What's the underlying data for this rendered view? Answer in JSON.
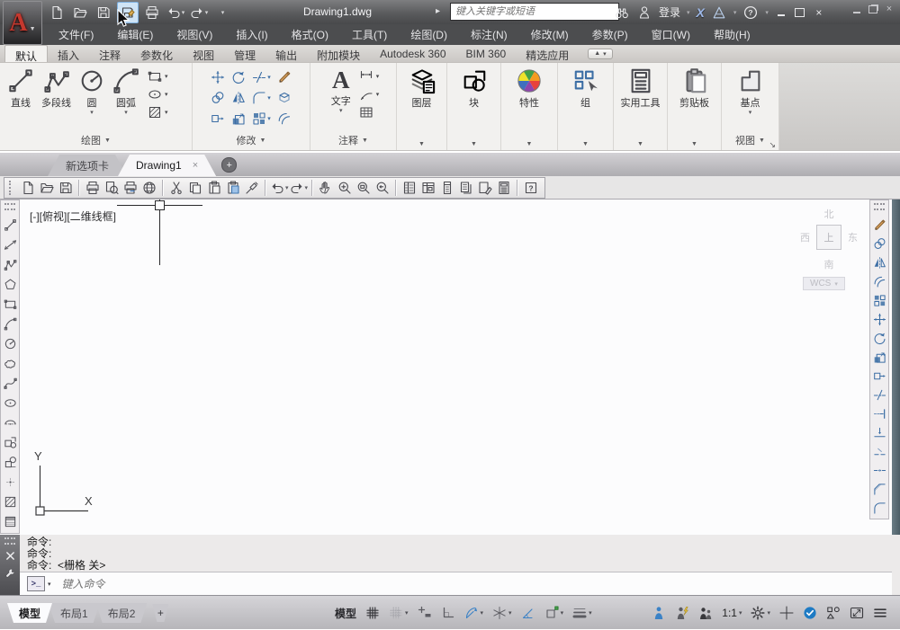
{
  "titlebar": {
    "title": "Drawing1.dwg",
    "overflow_arrow": "▸",
    "search_placeholder": "键入关键字或短语",
    "login": "登录",
    "qat": [
      {
        "icon": "new",
        "name": "qat-new-button"
      },
      {
        "icon": "open",
        "name": "qat-open-button"
      },
      {
        "icon": "save",
        "name": "qat-save-button"
      },
      {
        "icon": "saveas",
        "name": "qat-saveas-button",
        "highlight": true
      },
      {
        "icon": "print",
        "name": "qat-plot-button"
      },
      {
        "icon": "undo",
        "name": "qat-undo-button",
        "dd": "▾"
      },
      {
        "icon": "redo",
        "name": "qat-redo-button",
        "dd": "▾"
      },
      {
        "name": "qat-menu-button",
        "dd": "▾"
      }
    ]
  },
  "menubar": {
    "items": [
      "文件(F)",
      "编辑(E)",
      "视图(V)",
      "插入(I)",
      "格式(O)",
      "工具(T)",
      "绘图(D)",
      "标注(N)",
      "修改(M)",
      "参数(P)",
      "窗口(W)",
      "帮助(H)"
    ]
  },
  "ribbon": {
    "tabs": [
      {
        "label": "默认",
        "active": true
      },
      {
        "label": "插入"
      },
      {
        "label": "注释"
      },
      {
        "label": "参数化"
      },
      {
        "label": "视图"
      },
      {
        "label": "管理"
      },
      {
        "label": "输出"
      },
      {
        "label": "附加模块"
      },
      {
        "label": "Autodesk 360"
      },
      {
        "label": "BIM 360"
      },
      {
        "label": "精选应用"
      }
    ],
    "panel_dd": "▼",
    "panels": {
      "draw": {
        "label": "绘图",
        "big": [
          {
            "icon": "line",
            "label": "直线"
          },
          {
            "icon": "polyline",
            "label": "多段线"
          },
          {
            "icon": "circle",
            "label": "圆",
            "dd": "▾"
          },
          {
            "icon": "arc",
            "label": "圆弧",
            "dd": "▾"
          }
        ],
        "small": [
          {
            "icon": "rectangle",
            "dd": "▾"
          },
          {
            "icon": "ellipse",
            "dd": "▾"
          },
          {
            "icon": "hatch",
            "dd": "▾"
          }
        ]
      },
      "modify": {
        "label": "修改",
        "grid": [
          {
            "icon": "move"
          },
          {
            "icon": "copy"
          },
          {
            "icon": "stretch"
          },
          {
            "icon": "rotate"
          },
          {
            "icon": "mirror"
          },
          {
            "icon": "scale"
          },
          {
            "icon": "trim",
            "dd": "▾"
          },
          {
            "icon": "fillet",
            "dd": "▾"
          },
          {
            "icon": "array",
            "dd": "▾"
          },
          {
            "icon": "erase"
          },
          {
            "icon": "explode"
          },
          {
            "icon": "offset"
          }
        ]
      },
      "annotate": {
        "label": "注释",
        "text_label": "文字",
        "text_dd": "▾",
        "small": [
          {
            "icon": "dimension",
            "dd": "▾"
          },
          {
            "icon": "leader",
            "dd": "▾"
          },
          {
            "icon": "table"
          }
        ]
      },
      "layers": {
        "button": "图层"
      },
      "block": {
        "button": "块"
      },
      "properties": {
        "button": "特性"
      },
      "groups": {
        "button": "组"
      },
      "utilities": {
        "button": "实用工具"
      },
      "clipboard": {
        "button": "剪贴板"
      },
      "view": {
        "label": "视图",
        "button": "基点",
        "dd": "▾",
        "launcher": "↘"
      }
    }
  },
  "file_tabs": {
    "new_tab": "新选项卡",
    "active_tab": "Drawing1",
    "close": "×",
    "plus": "+"
  },
  "toolbar2": [
    {
      "icon": "new"
    },
    {
      "icon": "open"
    },
    {
      "icon": "save"
    },
    {
      "sep": true
    },
    {
      "icon": "print"
    },
    {
      "icon": "preview"
    },
    {
      "icon": "plot"
    },
    {
      "icon": "publish"
    },
    {
      "sep": true
    },
    {
      "icon": "cut"
    },
    {
      "icon": "copyclip"
    },
    {
      "icon": "paste"
    },
    {
      "icon": "pasteblock"
    },
    {
      "icon": "matchprop"
    },
    {
      "sep": true
    },
    {
      "icon": "undo",
      "dd": "▾"
    },
    {
      "icon": "redo",
      "dd": "▾"
    },
    {
      "sep": true
    },
    {
      "icon": "pan"
    },
    {
      "icon": "zoomrt"
    },
    {
      "icon": "zoomwin"
    },
    {
      "icon": "zoomprev"
    },
    {
      "sep": true
    },
    {
      "icon": "properties"
    },
    {
      "icon": "designcenter"
    },
    {
      "icon": "toolpalettes"
    },
    {
      "icon": "sheetset"
    },
    {
      "icon": "markup"
    },
    {
      "icon": "calculator"
    },
    {
      "sep": true
    },
    {
      "icon": "help"
    }
  ],
  "left_toolbar": [
    {
      "icon": "line"
    },
    {
      "icon": "xline"
    },
    {
      "icon": "polyline"
    },
    {
      "icon": "polygon"
    },
    {
      "icon": "rectangle"
    },
    {
      "icon": "arc"
    },
    {
      "icon": "circle"
    },
    {
      "icon": "revcloud"
    },
    {
      "icon": "spline"
    },
    {
      "icon": "ellipse"
    },
    {
      "icon": "ellipsearc"
    },
    {
      "icon": "insblock"
    },
    {
      "icon": "mkblock"
    },
    {
      "icon": "point"
    },
    {
      "icon": "hatch"
    },
    {
      "icon": "gradient"
    }
  ],
  "right_toolbar": [
    {
      "icon": "erase"
    },
    {
      "icon": "copy"
    },
    {
      "icon": "mirror"
    },
    {
      "icon": "offset"
    },
    {
      "icon": "array"
    },
    {
      "icon": "move"
    },
    {
      "icon": "rotate"
    },
    {
      "icon": "scale"
    },
    {
      "icon": "stretch"
    },
    {
      "icon": "trim"
    },
    {
      "icon": "extend"
    },
    {
      "icon": "breakpt"
    },
    {
      "icon": "break"
    },
    {
      "icon": "join"
    },
    {
      "icon": "chamfer"
    },
    {
      "icon": "fillet"
    }
  ],
  "canvas": {
    "viewport_label": "[-][俯视][二维线框]",
    "viewcube": {
      "north": "北",
      "west": "西",
      "top": "上",
      "east": "东",
      "south": "南",
      "wcs": "WCS",
      "wcs_dd": "▾"
    },
    "ucs": {
      "x": "X",
      "y": "Y"
    }
  },
  "command": {
    "history": [
      "命令:",
      "命令:",
      "命令:  <栅格 关>"
    ],
    "prompt": ">_",
    "prompt_dd": "▾",
    "placeholder": "键入命令"
  },
  "statusbar": {
    "layout_tabs": [
      {
        "label": "模型",
        "active": true,
        "name": "model-tab"
      },
      {
        "label": "布局1",
        "name": "layout1-tab"
      },
      {
        "label": "布局2",
        "name": "layout2-tab"
      }
    ],
    "plus": "+",
    "left": [
      {
        "label": "模型",
        "name": "model-paper-toggle"
      },
      {
        "icon": "grid",
        "tone": "dark",
        "name": "grid-display-toggle"
      },
      {
        "icon": "gridlight",
        "tone": "gray",
        "dd": "▾",
        "name": "snap-mode-toggle"
      },
      {
        "icon": "snap",
        "tone": "mid",
        "name": "infer-constraints-toggle"
      },
      {
        "icon": "ortho",
        "tone": "mid",
        "name": "ortho-mode-toggle"
      },
      {
        "icon": "polar",
        "tone": "blue",
        "dd": "▾",
        "name": "polar-tracking-toggle"
      },
      {
        "icon": "isodraft",
        "tone": "mid",
        "dd": "▾",
        "name": "isometric-drafting-toggle"
      },
      {
        "icon": "otrack",
        "tone": "blue",
        "name": "object-snap-tracking-toggle"
      },
      {
        "icon": "osnap",
        "tone": "mid",
        "dd": "▾",
        "name": "object-snap-toggle"
      },
      {
        "icon": "lweight",
        "tone": "mid",
        "dd": "▾",
        "name": "lineweight-toggle"
      }
    ],
    "right": [
      {
        "icon": "annovis",
        "tone": "blue",
        "name": "annotation-visibility-toggle"
      },
      {
        "icon": "autoscale",
        "tone": "mid",
        "name": "annotation-autoscale-to​ggle"
      },
      {
        "icon": "annoscale",
        "tone": "dark",
        "name": "annotation-scale-indicator"
      },
      {
        "label": "1:1",
        "dd": "▾",
        "name": "annotation-scale-button"
      },
      {
        "icon": "gear",
        "tone": "dark",
        "dd": "▾",
        "name": "workspace-switching-button"
      },
      {
        "icon": "crosshair",
        "tone": "dark",
        "name": "ui-lock-toggle"
      },
      {
        "icon": "perf",
        "name": "hardware-acceleration-indicator"
      },
      {
        "icon": "isolate",
        "tone": "dark",
        "name": "isolate-objects-button"
      },
      {
        "icon": "fullscreen",
        "tone": "dark",
        "name": "clean-screen-button"
      },
      {
        "icon": "menu",
        "tone": "dark",
        "name": "customization-menu-button"
      }
    ]
  }
}
